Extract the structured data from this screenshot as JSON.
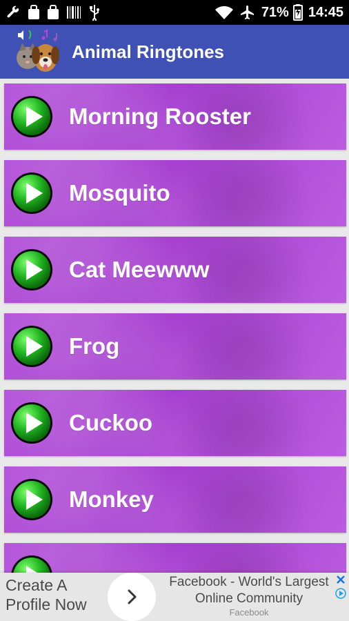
{
  "status_bar": {
    "battery_percent": "71%",
    "time": "14:45"
  },
  "app_bar": {
    "title": "Animal Ringtones",
    "logo_icon": "dog-and-cat-logo"
  },
  "list": {
    "items": [
      {
        "label": "Morning Rooster",
        "icon": "play-icon"
      },
      {
        "label": "Mosquito",
        "icon": "play-icon"
      },
      {
        "label": "Cat Meewww",
        "icon": "play-icon"
      },
      {
        "label": "Frog",
        "icon": "play-icon"
      },
      {
        "label": "Cuckoo",
        "icon": "play-icon"
      },
      {
        "label": "Monkey",
        "icon": "play-icon"
      },
      {
        "label": "",
        "icon": "play-icon"
      }
    ]
  },
  "ad": {
    "cta_line1": "Create A",
    "cta_line2": "Profile Now",
    "headline_line1": "Facebook - World's Largest",
    "headline_line2": "Online Community",
    "advertiser": "Facebook"
  },
  "colors": {
    "status_bar": "#000000",
    "app_bar": "#3f51b5",
    "row": "#b04ed6",
    "play_green": "#22b522"
  }
}
